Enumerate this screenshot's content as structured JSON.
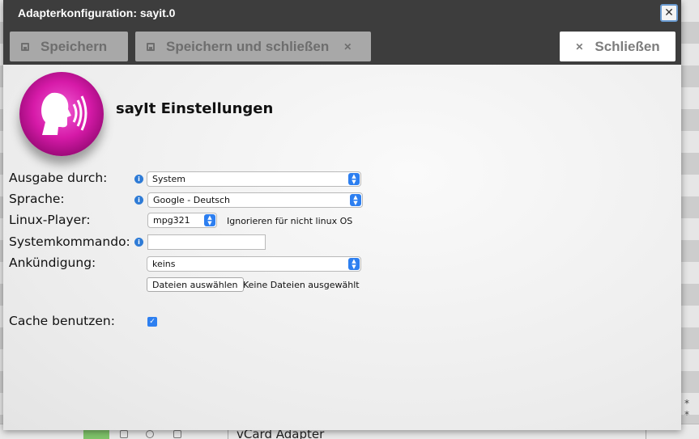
{
  "dialog": {
    "title": "Adapterkonfiguration: sayit.0",
    "close_icon": "close-icon"
  },
  "toolbar": {
    "save_label": "Speichern",
    "save_close_label": "Speichern und schließen",
    "close_label": "Schließen"
  },
  "header": {
    "title": "sayIt Einstellungen",
    "logo": "speaking-head-icon"
  },
  "form": {
    "output": {
      "label": "Ausgabe durch:",
      "value": "System"
    },
    "language": {
      "label": "Sprache:",
      "value": "Google - Deutsch"
    },
    "linux_player": {
      "label": "Linux-Player:",
      "value": "mpg321",
      "hint": "Ignorieren für nicht linux OS"
    },
    "system_command": {
      "label": "Systemkommando:",
      "value": ""
    },
    "announcement": {
      "label": "Ankündigung:",
      "value": "keins"
    },
    "file": {
      "button": "Dateien auswählen",
      "status": "Keine Dateien ausgewählt"
    },
    "cache": {
      "label": "Cache benutzen:",
      "checked": true
    }
  },
  "background": {
    "row_text": "vCard Adapter",
    "stars": "* *"
  },
  "colors": {
    "titlebar": "#3d3d3d",
    "accent": "#2d7ff0",
    "logo_magenta": "#d61aa8"
  }
}
